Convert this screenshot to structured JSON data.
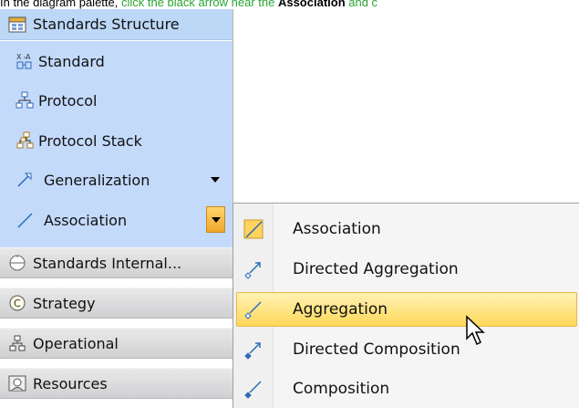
{
  "instruction": {
    "lead": "In the diagram palette, ",
    "link": "click the black arrow near the ",
    "strong": "Association",
    "tail": " and c"
  },
  "palette": {
    "expanded_group": {
      "label": "Standards Structure",
      "icon": "standards-structure-icon"
    },
    "tools": [
      {
        "label": "Standard",
        "icon": "standard-icon"
      },
      {
        "label": "Protocol",
        "icon": "protocol-icon"
      },
      {
        "label": "Protocol Stack",
        "icon": "protocol-stack-icon"
      },
      {
        "label": "Generalization",
        "icon": "generalization-icon"
      },
      {
        "label": "Association",
        "icon": "association-icon"
      }
    ],
    "collapsed_groups": [
      {
        "label": "Standards Internal...",
        "icon": "standards-internal-icon"
      },
      {
        "label": "Strategy",
        "icon": "strategy-icon"
      },
      {
        "label": "Operational",
        "icon": "operational-icon"
      },
      {
        "label": "Resources",
        "icon": "resources-icon"
      }
    ]
  },
  "menu": {
    "items": [
      {
        "label": "Association",
        "icon": "association-icon"
      },
      {
        "label": "Directed Aggregation",
        "icon": "directed-aggregation-icon"
      },
      {
        "label": "Aggregation",
        "icon": "aggregation-icon",
        "highlighted": true
      },
      {
        "label": "Directed Composition",
        "icon": "directed-composition-icon"
      },
      {
        "label": "Composition",
        "icon": "composition-icon"
      }
    ]
  },
  "colors": {
    "palette_bg": "#c3dafb",
    "highlight": "#ffd85a",
    "link_green": "#2aa531"
  }
}
